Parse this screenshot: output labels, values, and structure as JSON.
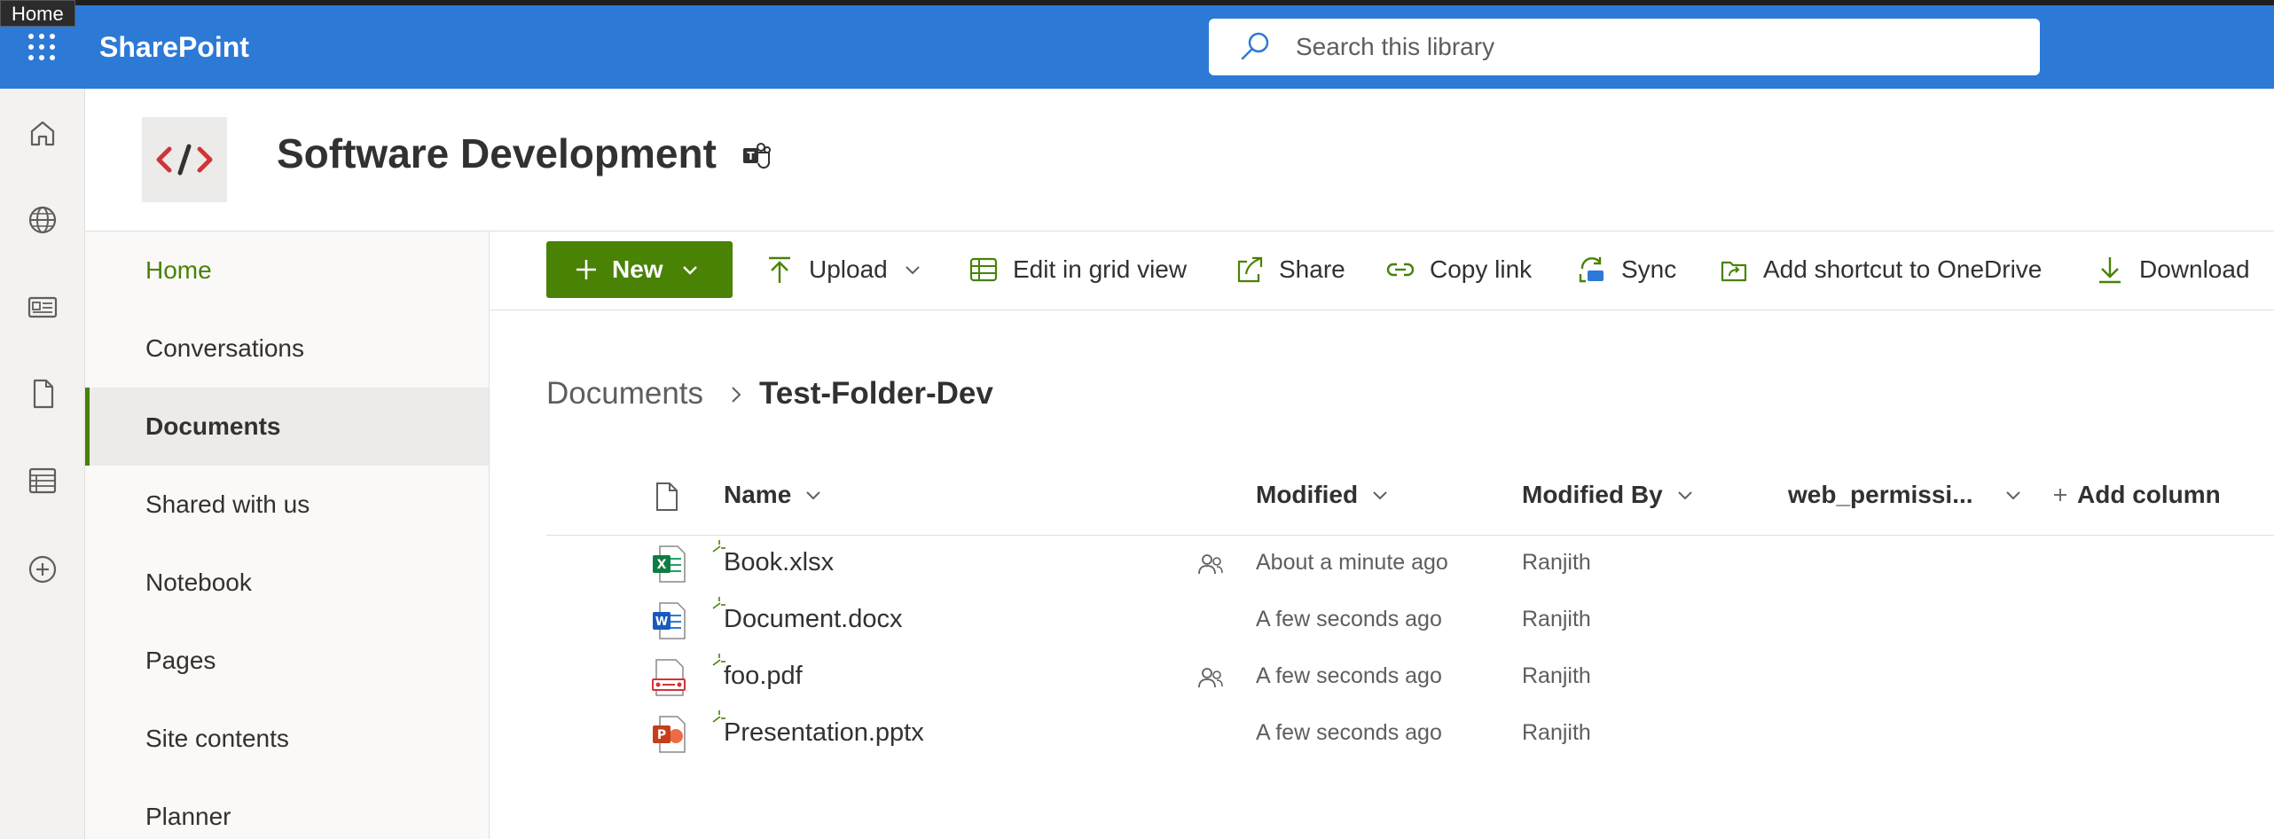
{
  "tooltip": "Home",
  "suite": {
    "brand": "SharePoint",
    "search_placeholder": "Search this library"
  },
  "site": {
    "title": "Software Development",
    "logo_text": "</>"
  },
  "leftnav": {
    "items": [
      {
        "label": "Home"
      },
      {
        "label": "Conversations"
      },
      {
        "label": "Documents"
      },
      {
        "label": "Shared with us"
      },
      {
        "label": "Notebook"
      },
      {
        "label": "Pages"
      },
      {
        "label": "Site contents"
      },
      {
        "label": "Planner"
      }
    ]
  },
  "commands": {
    "new": "New",
    "upload": "Upload",
    "edit_grid": "Edit in grid view",
    "share": "Share",
    "copy_link": "Copy link",
    "sync": "Sync",
    "add_shortcut": "Add shortcut to OneDrive",
    "download": "Download"
  },
  "breadcrumb": {
    "root": "Documents",
    "current": "Test-Folder-Dev"
  },
  "columns": {
    "name": "Name",
    "modified": "Modified",
    "modified_by": "Modified By",
    "web_perm": "web_permissi...",
    "add_column": "Add column"
  },
  "files": [
    {
      "name": "Book.xlsx",
      "type": "excel-icon",
      "modified": "About a minute ago",
      "modified_by": "Ranjith",
      "shared": true
    },
    {
      "name": "Document.docx",
      "type": "word-icon",
      "modified": "A few seconds ago",
      "modified_by": "Ranjith",
      "shared": false
    },
    {
      "name": "foo.pdf",
      "type": "pdf-icon",
      "modified": "A few seconds ago",
      "modified_by": "Ranjith",
      "shared": true
    },
    {
      "name": "Presentation.pptx",
      "type": "powerpoint-icon",
      "modified": "A few seconds ago",
      "modified_by": "Ranjith",
      "shared": false
    }
  ],
  "colors": {
    "suite_bar": "#2d79d6",
    "accent_green": "#498205"
  }
}
